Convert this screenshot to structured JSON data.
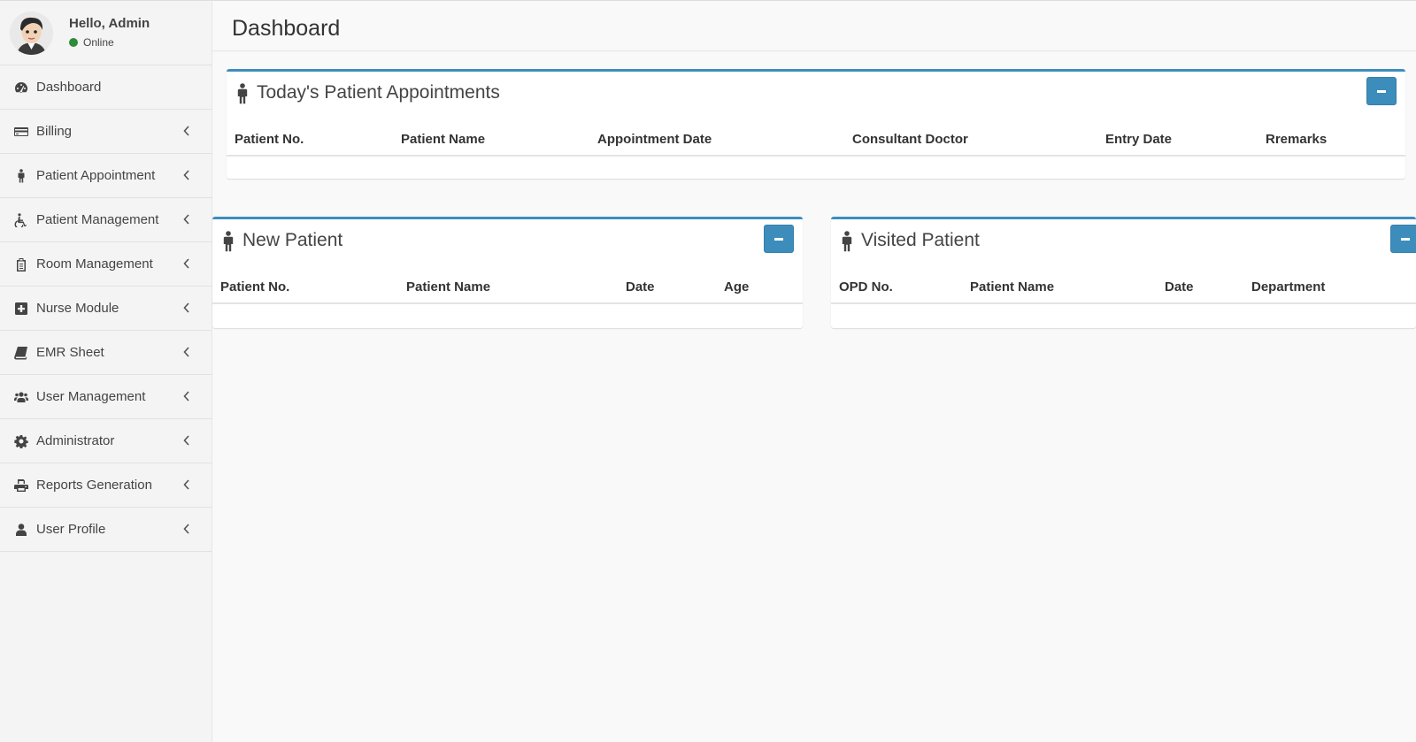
{
  "user": {
    "greeting": "Hello, Admin",
    "status": "Online",
    "status_color": "#2e8b3a"
  },
  "sidebar": {
    "items": [
      {
        "label": "Dashboard",
        "icon": "dashboard-icon",
        "has_submenu": false
      },
      {
        "label": "Billing",
        "icon": "credit-card-icon",
        "has_submenu": true
      },
      {
        "label": "Patient Appointment",
        "icon": "male-icon",
        "has_submenu": true
      },
      {
        "label": "Patient Management",
        "icon": "wheelchair-icon",
        "has_submenu": true
      },
      {
        "label": "Room Management",
        "icon": "clipboard-icon",
        "has_submenu": true
      },
      {
        "label": "Nurse Module",
        "icon": "plus-square-icon",
        "has_submenu": true
      },
      {
        "label": "EMR Sheet",
        "icon": "book-icon",
        "has_submenu": true
      },
      {
        "label": "User Management",
        "icon": "users-icon",
        "has_submenu": true
      },
      {
        "label": "Administrator",
        "icon": "gear-icon",
        "has_submenu": true
      },
      {
        "label": "Reports Generation",
        "icon": "print-icon",
        "has_submenu": true
      },
      {
        "label": "User Profile",
        "icon": "user-icon",
        "has_submenu": true
      }
    ]
  },
  "page": {
    "title": "Dashboard"
  },
  "appointments": {
    "title": "Today's Patient Appointments",
    "columns": [
      "Patient No.",
      "Patient Name",
      "Appointment Date",
      "Consultant Doctor",
      "Entry Date",
      "Rremarks"
    ]
  },
  "new_patient": {
    "title": "New Patient",
    "columns": [
      "Patient No.",
      "Patient Name",
      "Date",
      "Age"
    ]
  },
  "visited_patient": {
    "title": "Visited Patient",
    "columns": [
      "OPD No.",
      "Patient Name",
      "Date",
      "Department"
    ]
  },
  "colors": {
    "accent": "#3c8dbc",
    "sidebar_bg": "#f4f4f4",
    "page_bg": "#f9f9f9"
  }
}
